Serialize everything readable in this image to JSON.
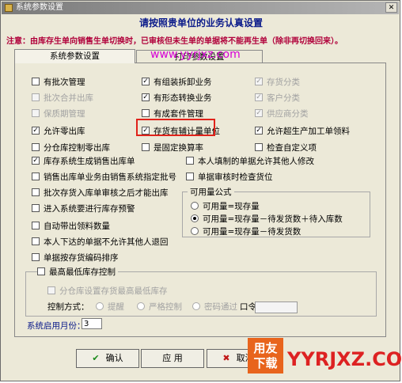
{
  "window": {
    "title": "系统参数设置",
    "close_glyph": "✕"
  },
  "header": {
    "title": "请按照贵单位的业务认真设置",
    "notice": "注意：由库存生单向销售生单切换时，已审核但未生单的单据将不能再生单（除非再切换回来）。"
  },
  "tabs": [
    {
      "label": "系统参数设置",
      "active": true
    },
    {
      "label": "打印参数设置",
      "active": false
    }
  ],
  "watermark": "www.yyrjxz.com",
  "options": {
    "yjgl": {
      "label": "有批次管理",
      "checked": false,
      "enabled": true
    },
    "yzzcx": {
      "label": "有组装拆卸业务",
      "checked": true,
      "enabled": true
    },
    "chfl": {
      "label": "存货分类",
      "checked": true,
      "enabled": false
    },
    "pchchk": {
      "label": "批次合并出库",
      "checked": false,
      "enabled": false
    },
    "yxtzh": {
      "label": "有形态转换业务",
      "checked": true,
      "enabled": true
    },
    "khfl": {
      "label": "客户分类",
      "checked": true,
      "enabled": false
    },
    "bzqgl": {
      "label": "保质期管理",
      "checked": false,
      "enabled": false
    },
    "ycbj": {
      "label": "有成套件管理",
      "checked": false,
      "enabled": true
    },
    "gysfl": {
      "label": "供应商分类",
      "checked": true,
      "enabled": false
    },
    "yxlck": {
      "label": "允许零出库",
      "checked": true,
      "enabled": true
    },
    "chyfz": {
      "label": "存货有辅计量单位",
      "checked": true,
      "enabled": true
    },
    "yxcsc": {
      "label": "允许超生产加工单领料",
      "checked": true,
      "enabled": true
    },
    "fcck": {
      "label": "分仓库控制零出库",
      "checked": false,
      "enabled": true
    },
    "sgdhs": {
      "label": "是固定换算率",
      "checked": false,
      "enabled": true
    },
    "jczdy": {
      "label": "检查自定义项",
      "checked": false,
      "enabled": true
    },
    "kcxt": {
      "label": "库存系统生成销售出库单",
      "checked": true,
      "enabled": true
    },
    "brtx": {
      "label": "本人填制的单据允许其他人修改",
      "checked": false,
      "enabled": true
    },
    "xsck": {
      "label": "销售出库单业务由销售系统指定批号",
      "checked": false,
      "enabled": true
    },
    "djsh": {
      "label": "单据审核时检查货位",
      "checked": false,
      "enabled": true
    },
    "pcrk": {
      "label": "批次存货入库单审核之后才能出库",
      "checked": false,
      "enabled": true
    },
    "jrxt": {
      "label": "进入系统要进行库存预警",
      "checked": false,
      "enabled": true
    },
    "zddc": {
      "label": "自动带出领料数量",
      "checked": false,
      "enabled": true
    },
    "brxd": {
      "label": "本人下达的单据不允许其他人退回",
      "checked": false,
      "enabled": true
    },
    "djah": {
      "label": "单据按存货编码排序",
      "checked": false,
      "enabled": true
    }
  },
  "availability": {
    "title": "可用量公式",
    "options": [
      {
        "label": "可用量=现存量",
        "selected": false
      },
      {
        "label": "可用量=现存量－待发货数＋待入库数",
        "selected": true
      },
      {
        "label": "可用量=现存量－待发货数",
        "selected": false
      }
    ]
  },
  "max_stock": {
    "title": "最高最低库存控制",
    "checked": false,
    "by_warehouse": {
      "label": "分仓库设置存货最高最低库存",
      "checked": false
    },
    "control_label": "控制方式：",
    "control_options": [
      "提醒",
      "严格控制",
      "密码通过"
    ],
    "password_label": "口令："
  },
  "month": {
    "label": "系统启用月份：",
    "value": "3"
  },
  "buttons": {
    "ok": {
      "label": "确认",
      "icon": "✔"
    },
    "apply": {
      "label": "应 用"
    },
    "cancel": {
      "label": "取消",
      "icon": "✖"
    }
  },
  "logo": {
    "line1": "用友",
    "line2": "下载",
    "text": "YYRJXZ.COM"
  },
  "colors": {
    "title_blue": "#0a1a8a",
    "notice_red": "#b0003a",
    "highlight_red": "#e0221a",
    "watermark_magenta": "#d600d6",
    "logo_orange": "#e8641c"
  }
}
